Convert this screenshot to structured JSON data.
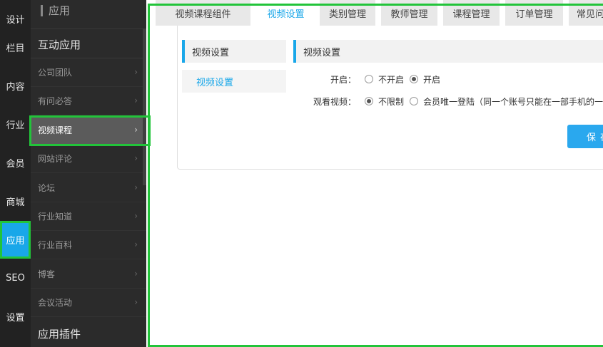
{
  "rail": {
    "items": [
      {
        "label": "设计",
        "active": false
      },
      {
        "label": "栏目",
        "active": false
      },
      {
        "label": "内容",
        "active": false
      },
      {
        "label": "行业",
        "active": false
      },
      {
        "label": "会员",
        "active": false
      },
      {
        "label": "商城",
        "active": false
      },
      {
        "label": "应用",
        "active": true
      },
      {
        "label": "SEO",
        "active": false
      },
      {
        "label": "设置",
        "active": false
      }
    ]
  },
  "submenu": {
    "header": "应用",
    "section1": "互动应用",
    "items": [
      {
        "label": "公司团队",
        "active": false
      },
      {
        "label": "有问必答",
        "active": false
      },
      {
        "label": "视频课程",
        "active": true
      },
      {
        "label": "网站评论",
        "active": false
      },
      {
        "label": "论坛",
        "active": false
      },
      {
        "label": "行业知道",
        "active": false
      },
      {
        "label": "行业百科",
        "active": false
      },
      {
        "label": "博客",
        "active": false
      },
      {
        "label": "会议活动",
        "active": false
      }
    ],
    "section2": "应用插件",
    "chevron": "›"
  },
  "tabs": [
    {
      "label": "视频课程组件",
      "active": false
    },
    {
      "label": "视频设置",
      "active": true
    },
    {
      "label": "类别管理",
      "active": false
    },
    {
      "label": "教师管理",
      "active": false
    },
    {
      "label": "课程管理",
      "active": false
    },
    {
      "label": "订单管理",
      "active": false
    },
    {
      "label": "常见问",
      "active": false
    }
  ],
  "panel": {
    "left_header": "视频设置",
    "left_link": "视频设置",
    "right_header": "视频设置",
    "enable": {
      "label": "开启：",
      "options": [
        {
          "label": "不开启",
          "checked": false
        },
        {
          "label": "开启",
          "checked": true
        }
      ]
    },
    "watch": {
      "label": "观看视频：",
      "options": [
        {
          "label": "不限制",
          "checked": true
        },
        {
          "label": "会员唯一登陆（同一个账号只能在一部手机的一",
          "checked": false
        }
      ]
    },
    "save_label": "保存"
  },
  "colors": {
    "accent": "#19a7e9",
    "highlight": "#22c43a"
  }
}
